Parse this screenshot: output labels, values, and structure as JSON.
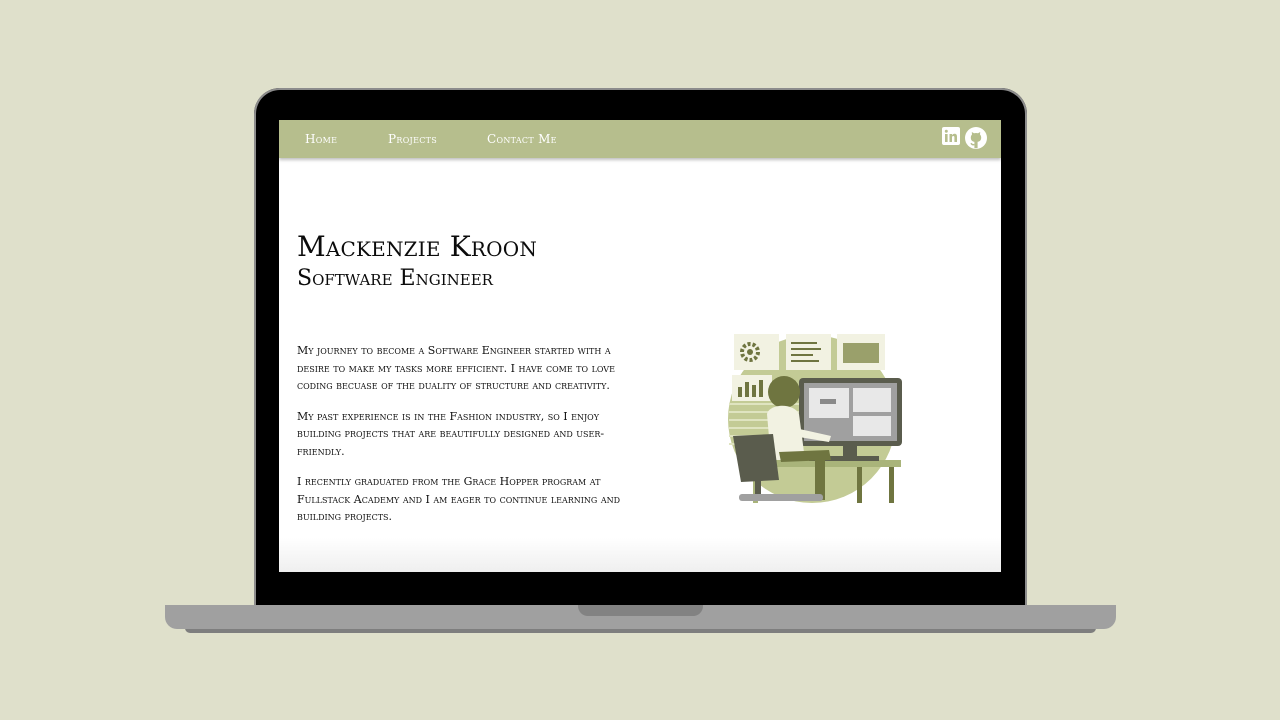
{
  "nav": {
    "links": [
      "Home",
      "Projects",
      "Contact Me"
    ],
    "icons": [
      "linkedin-icon",
      "github-icon"
    ]
  },
  "hero": {
    "name": "Mackenzie Kroon",
    "title": "Software Engineer"
  },
  "about": {
    "paragraphs": [
      "My journey to become a Software Engineer started with a desire to make my tasks more efficient. I have come to love coding becuase of the duality of structure and creativity.",
      "My past experience is in the Fashion industry, so I enjoy building projects that are beautifully designed and user-friendly.",
      "I recently graduated from the Grace Hopper program at Fullstack Academy and I am eager to continue learning and building projects."
    ]
  },
  "colors": {
    "background": "#dfe0cb",
    "navbar": "#b6be8d",
    "accent_dark": "#6f7540",
    "accent_light": "#c3cb95"
  }
}
